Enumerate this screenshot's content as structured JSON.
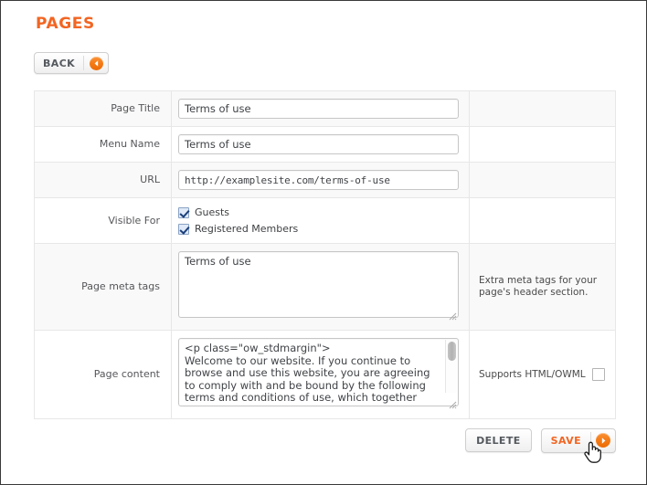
{
  "page": {
    "title": "PAGES"
  },
  "toolbar": {
    "back_label": "BACK",
    "back_icon": "circle-arrow-left-icon"
  },
  "colors": {
    "accent_orange": "#f26522",
    "button_text": "#555a5f",
    "row_alt_bg": "#f9f9f9",
    "table_border": "#e7e7e7"
  },
  "form": {
    "rows": [
      {
        "label": "Page Title",
        "type": "text",
        "value": "Terms of use",
        "placeholder": "",
        "help": ""
      },
      {
        "label": "Menu Name",
        "type": "text",
        "value": "Terms of use",
        "placeholder": "",
        "help": ""
      },
      {
        "label": "URL",
        "type": "text-mono",
        "value": "http://examplesite.com/terms-of-use",
        "placeholder": "",
        "help": ""
      },
      {
        "label": "Visible For",
        "type": "checkboxes",
        "help": "",
        "options": [
          {
            "label": "Guests",
            "checked": true
          },
          {
            "label": "Registered Members",
            "checked": true
          }
        ]
      },
      {
        "label": "Page meta tags",
        "type": "textarea",
        "value": "Terms of use",
        "help": "Extra meta tags for your page's header section."
      },
      {
        "label": "Page content",
        "type": "textarea-scroll",
        "value": "<p class=\"ow_stdmargin\">\nWelcome to our website. If you continue to browse and use this website, you are agreeing to comply with and be bound by the following terms and conditions of use, which together with our privacy policy govern our relationship with you in relation to this website. If you",
        "help_label": "Supports HTML/OWML",
        "help_checkbox_checked": false
      }
    ]
  },
  "footer": {
    "delete_label": "DELETE",
    "save_label": "SAVE",
    "save_icon": "circle-arrow-right-icon"
  },
  "cursor": {
    "type": "pointing-hand-cursor"
  }
}
